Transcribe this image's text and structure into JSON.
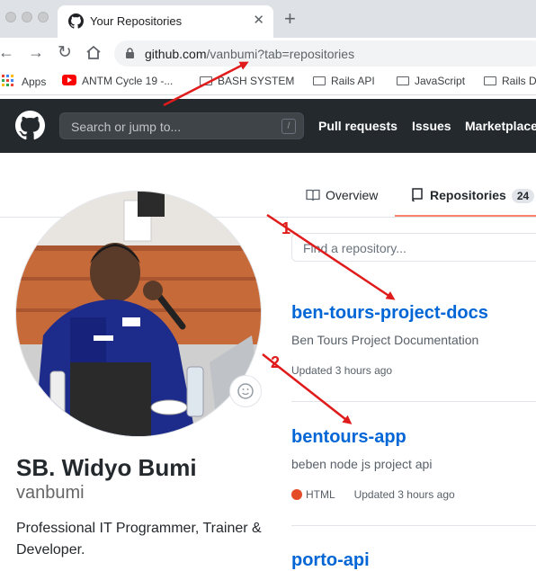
{
  "browser": {
    "tab_title": "Your Repositories",
    "tab_close": "✕",
    "new_tab": "+",
    "url_host": "github.com",
    "url_path": "/vanbumi?tab=repositories",
    "bookmarks": [
      {
        "label": "Apps",
        "icon": "apps-grid-icon"
      },
      {
        "label": "ANTM Cycle 19 -...",
        "icon": "youtube-icon"
      },
      {
        "label": "BASH SYSTEM",
        "icon": "folder-icon"
      },
      {
        "label": "Rails API",
        "icon": "folder-icon"
      },
      {
        "label": "JavaScript",
        "icon": "folder-icon"
      },
      {
        "label": "Rails D",
        "icon": "folder-icon"
      }
    ]
  },
  "github_header": {
    "search_placeholder": "Search or jump to...",
    "search_shortcut": "/",
    "nav": [
      "Pull requests",
      "Issues",
      "Marketplace"
    ]
  },
  "profile_tabs": {
    "overview": "Overview",
    "repositories": "Repositories",
    "repositories_count": "24"
  },
  "profile": {
    "name": "SB. Widyo Bumi",
    "login": "vanbumi",
    "bio": "Professional IT Programmer, Trainer & Developer."
  },
  "repo_filter": {
    "placeholder": "Find a repository..."
  },
  "repositories": [
    {
      "name": "ben-tours-project-docs",
      "description": "Ben Tours Project Documentation",
      "language": "",
      "updated": "Updated 3 hours ago"
    },
    {
      "name": "bentours-app",
      "description": "beben node js project api",
      "language": "HTML",
      "language_color": "#e34c26",
      "updated": "Updated 3 hours ago"
    },
    {
      "name": "porto-api"
    }
  ],
  "annotations": [
    "1",
    "2"
  ],
  "colors": {
    "annotation": "#e01b1b",
    "link": "#0366d6",
    "header_bg": "#24292e",
    "active_tab": "#f9826c"
  }
}
